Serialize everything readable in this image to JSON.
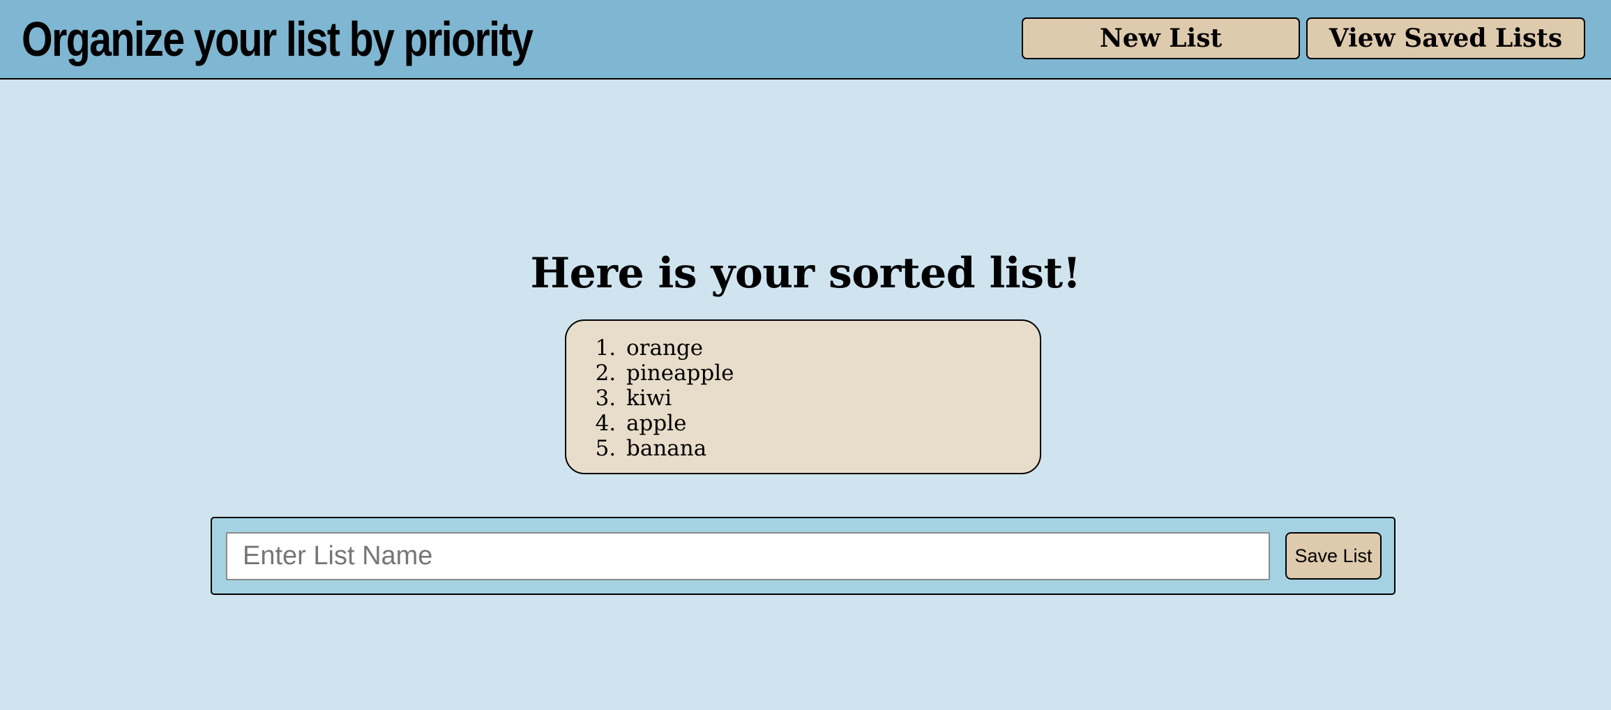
{
  "header": {
    "title": "Organize your list by priority",
    "new_list_label": "New List",
    "view_saved_label": "View Saved Lists"
  },
  "main": {
    "heading": "Here is your sorted list!",
    "sorted_items": [
      "orange",
      "pineapple",
      "kiwi",
      "apple",
      "banana"
    ]
  },
  "save_form": {
    "list_name_value": "",
    "list_name_placeholder": "Enter List Name",
    "save_label": "Save List"
  },
  "colors": {
    "page_background": "#cfe4ef",
    "header_background": "#7fb6d1",
    "button_background": "#decaad",
    "list_box_background": "#e8ddca",
    "save_bar_background": "#a4d2e3"
  }
}
